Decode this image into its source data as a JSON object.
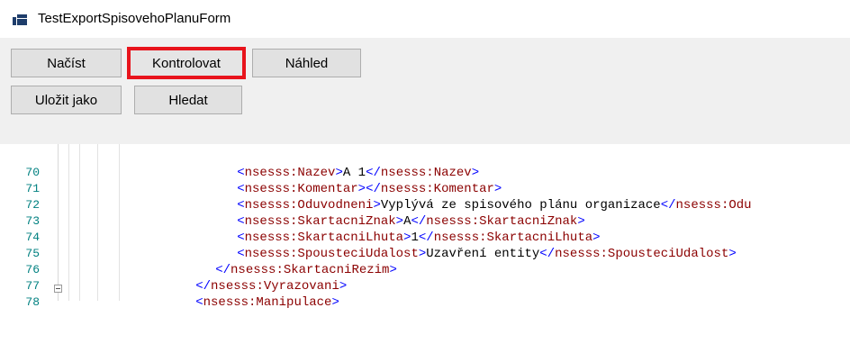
{
  "window": {
    "title": "TestExportSpisovehoPlanuForm",
    "icon": "app-window-icon"
  },
  "toolbar": {
    "load_label": "Načíst",
    "check_label": "Kontrolovat",
    "preview_label": "Náhled",
    "save_as_label": "Uložit jako",
    "search_label": "Hledat",
    "highlight_color": "#e8141c"
  },
  "editor": {
    "lines": [
      {
        "num": "70",
        "open": "<",
        "tag": "nsesss:Nazev",
        "close": ">",
        "value": "A 1",
        "end_open": "</",
        "end_tag": "nsesss:Nazev",
        "end_close": ">"
      },
      {
        "num": "71",
        "open": "<",
        "tag": "nsesss:Komentar",
        "close": ">",
        "value": "",
        "end_open": "</",
        "end_tag": "nsesss:Komentar",
        "end_close": ">"
      },
      {
        "num": "72",
        "open": "<",
        "tag": "nsesss:Oduvodneni",
        "close": ">",
        "value": "Vyplývá ze spisového plánu organizace",
        "end_open": "</",
        "end_tag": "nsesss:Odu",
        "end_close": ""
      },
      {
        "num": "73",
        "open": "<",
        "tag": "nsesss:SkartacniZnak",
        "close": ">",
        "value": "A",
        "end_open": "</",
        "end_tag": "nsesss:SkartacniZnak",
        "end_close": ">"
      },
      {
        "num": "74",
        "open": "<",
        "tag": "nsesss:SkartacniLhuta",
        "close": ">",
        "value": "1",
        "end_open": "</",
        "end_tag": "nsesss:SkartacniLhuta",
        "end_close": ">"
      },
      {
        "num": "75",
        "open": "<",
        "tag": "nsesss:SpousteciUdalost",
        "close": ">",
        "value": "Uzavření entity",
        "end_open": "</",
        "end_tag": "nsesss:SpousteciUdalost",
        "end_close": ">"
      },
      {
        "num": "76",
        "open": "</",
        "tag": "nsesss:SkartacniRezim",
        "close": ">",
        "value": "",
        "end_open": "",
        "end_tag": "",
        "end_close": ""
      },
      {
        "num": "77",
        "open": "</",
        "tag": "nsesss:Vyrazovani",
        "close": ">",
        "value": "",
        "end_open": "",
        "end_tag": "",
        "end_close": ""
      },
      {
        "num": "78",
        "open": "<",
        "tag": "nsesss:Manipulace",
        "close": ">",
        "value": "",
        "end_open": "",
        "end_tag": "",
        "end_close": ""
      }
    ],
    "colors": {
      "tag": "#8b0000",
      "bracket": "#0000ff",
      "line_number": "#008080"
    }
  }
}
